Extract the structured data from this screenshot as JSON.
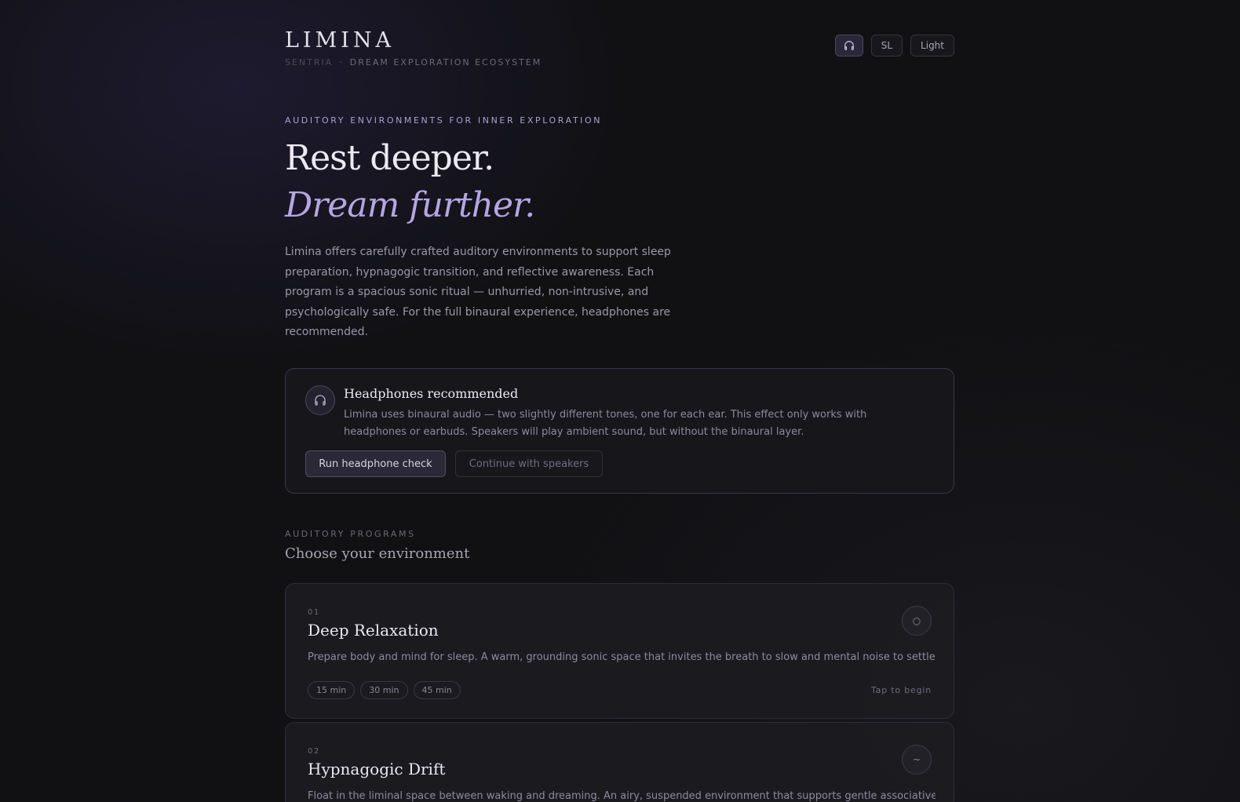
{
  "header": {
    "logo": "LIMINA",
    "brand_parent": "SENTRIA",
    "separator": "·",
    "tagline": "DREAM EXPLORATION ECOSYSTEM",
    "language_label": "SL",
    "theme_label": "Light"
  },
  "hero": {
    "eyebrow": "AUDITORY ENVIRONMENTS FOR INNER EXPLORATION",
    "headline_line1": "Rest deeper.",
    "headline_line2": "Dream further.",
    "intro": "Limina offers carefully crafted auditory environments to support sleep preparation, hypnagogic transition, and reflective awareness. Each program is a spacious sonic ritual — unhurried, non-intrusive, and psychologically safe. For the full binaural experience, headphones are recommended."
  },
  "headphones_card": {
    "title": "Headphones recommended",
    "body": "Limina uses binaural audio — two slightly different tones, one for each ear. This effect only works with headphones or earbuds. Speakers will play ambient sound, but without the binaural layer.",
    "primary_button": "Run headphone check",
    "secondary_button": "Continue with speakers"
  },
  "programs_section": {
    "eyebrow": "AUDITORY PROGRAMS",
    "title": "Choose your environment",
    "items": [
      {
        "number": "01",
        "title": "Deep Relaxation",
        "description": "Prepare body and mind for sleep. A warm, grounding sonic space that invites the breath to slow and mental noise to settle.",
        "glyph": "○",
        "durations": [
          "15 min",
          "30 min",
          "45 min"
        ],
        "cta": "Tap to begin"
      },
      {
        "number": "02",
        "title": "Hypnagogic Drift",
        "description": "Float in the liminal space between waking and dreaming. An airy, suspended environment that supports gentle associative imagery.",
        "glyph": "~"
      }
    ]
  },
  "colors": {
    "background": "#111114",
    "accent": "#b6a6e2",
    "text": "#ece9f2",
    "muted": "#8e8b99"
  }
}
